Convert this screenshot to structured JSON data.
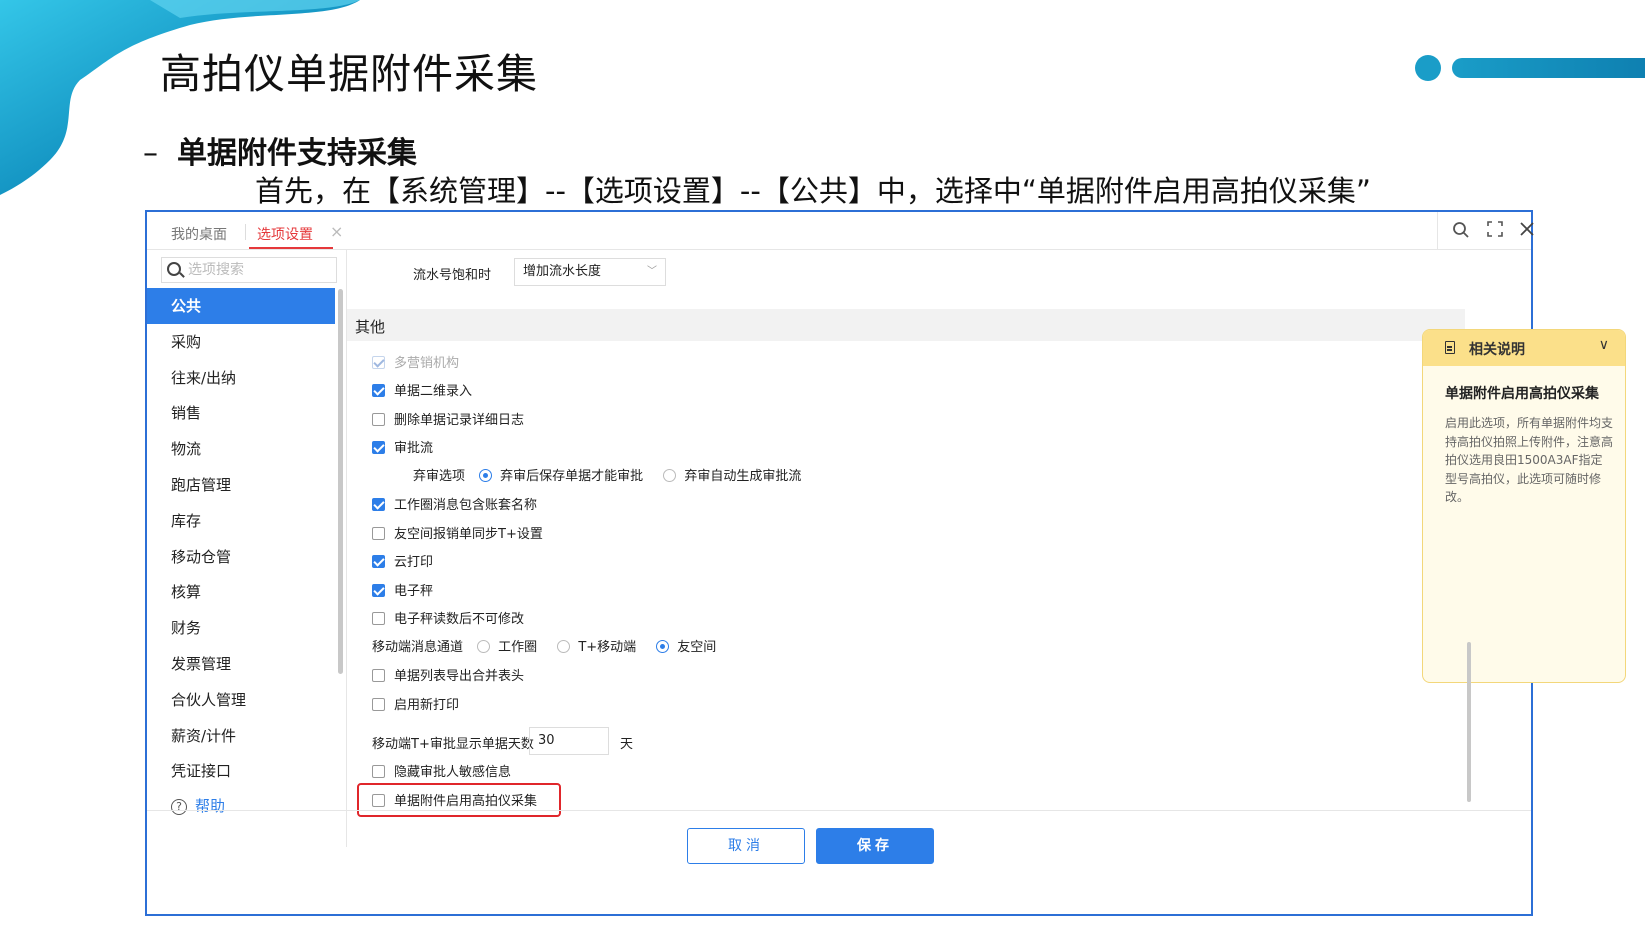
{
  "slide": {
    "title": "高拍仪单据附件采集",
    "bullet": "单据附件支持采集",
    "bullet_dash": "–",
    "description": "首先，在【系统管理】--【选项设置】--【公共】中，选择中“单据附件启用高拍仪采集”"
  },
  "colors": {
    "accent": "#2d7ee8",
    "highlight": "#e0262b",
    "deco": "#1a9dc8",
    "note_bg": "#fffbea"
  },
  "dialog": {
    "tabs": [
      {
        "label": "我的桌面",
        "active": false
      },
      {
        "label": "选项设置",
        "active": true
      }
    ],
    "tab_close_icon": "×",
    "window_controls": [
      "search-icon",
      "fullscreen-icon",
      "close-icon"
    ],
    "sidebar": {
      "search_placeholder": "选项搜索",
      "items": [
        "公共",
        "采购",
        "往来/出纳",
        "销售",
        "物流",
        "跑店管理",
        "库存",
        "移动仓管",
        "核算",
        "财务",
        "发票管理",
        "合伙人管理",
        "薪资/计件",
        "凭证接口"
      ],
      "active_index": 0,
      "help_label": "帮助"
    },
    "main": {
      "serial_label": "流水号饱和时",
      "serial_value": "增加流水长度",
      "section_title": "其他",
      "options": [
        {
          "label": "多营销机构",
          "checked": true,
          "disabled": true
        },
        {
          "label": "单据二维录入",
          "checked": true
        },
        {
          "label": "删除单据记录详细日志",
          "checked": false
        },
        {
          "label": "审批流",
          "checked": true
        },
        {
          "label": "工作圈消息包含账套名称",
          "checked": true
        },
        {
          "label": "友空间报销单同步T+设置",
          "checked": false
        },
        {
          "label": "云打印",
          "checked": true
        },
        {
          "label": "电子秤",
          "checked": true
        },
        {
          "label": "电子秤读数后不可修改",
          "checked": false
        },
        {
          "label": "单据列表导出合并表头",
          "checked": false
        },
        {
          "label": "启用新打印",
          "checked": false
        },
        {
          "label": "隐藏审批人敏感信息",
          "checked": false
        },
        {
          "label": "单据附件启用高拍仪采集",
          "checked": false
        }
      ],
      "abandon": {
        "label": "弃审选项",
        "choices": [
          "弃审后保存单据才能审批",
          "弃审自动生成审批流"
        ],
        "selected": 0
      },
      "msg_channel": {
        "label": "移动端消息通道",
        "choices": [
          "工作圈",
          "T+移动端",
          "友空间"
        ],
        "selected": 2
      },
      "days": {
        "label": "移动端T+审批显示单据天数",
        "value": "30",
        "unit": "天"
      }
    },
    "note": {
      "header": "相关说明",
      "title": "单据附件启用高拍仪采集",
      "body": "启用此选项，所有单据附件均支持高拍仪拍照上传附件，注意高拍仪选用良田1500A3AF指定型号高拍仪，此选项可随时修改。"
    },
    "footer": {
      "cancel": "取消",
      "save": "保存"
    }
  }
}
